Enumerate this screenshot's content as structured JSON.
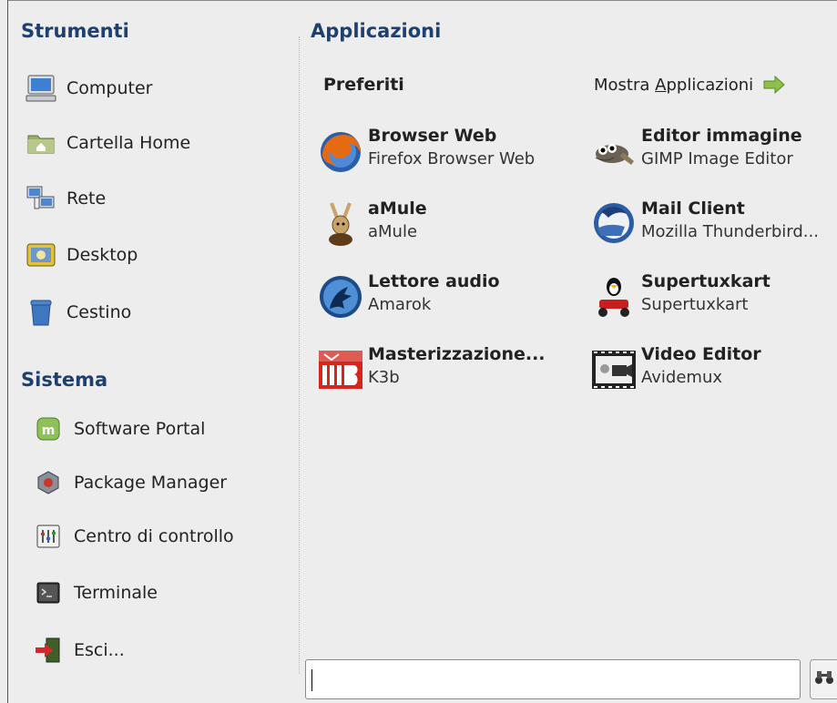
{
  "places": {
    "title": "Strumenti",
    "items": [
      {
        "label": "Computer",
        "icon": "computer-icon"
      },
      {
        "label": "Cartella Home",
        "icon": "home-folder-icon"
      },
      {
        "label": "Rete",
        "icon": "network-icon"
      },
      {
        "label": "Desktop",
        "icon": "desktop-icon"
      },
      {
        "label": "Cestino",
        "icon": "trash-icon"
      }
    ]
  },
  "system": {
    "title": "Sistema",
    "items": [
      {
        "label": "Software Portal",
        "icon": "software-portal-icon"
      },
      {
        "label": "Package Manager",
        "icon": "package-manager-icon"
      },
      {
        "label": "Centro di controllo",
        "icon": "control-center-icon"
      },
      {
        "label": "Terminale",
        "icon": "terminal-icon"
      },
      {
        "label": "Esci...",
        "icon": "logout-icon"
      }
    ]
  },
  "applications": {
    "title": "Applicazioni",
    "favorites_title": "Preferiti",
    "show_all_prefix": "Mostra ",
    "show_all_underlined": "A",
    "show_all_rest": "pplicazioni",
    "favorites": [
      {
        "name": "Browser Web",
        "desc": "Firefox Browser Web",
        "icon": "firefox-icon"
      },
      {
        "name": "Editor immagine",
        "desc": "GIMP Image Editor",
        "icon": "gimp-icon"
      },
      {
        "name": "aMule",
        "desc": "aMule",
        "icon": "amule-icon"
      },
      {
        "name": "Mail Client",
        "desc": "Mozilla Thunderbird...",
        "icon": "thunderbird-icon"
      },
      {
        "name": "Lettore audio",
        "desc": "Amarok",
        "icon": "amarok-icon"
      },
      {
        "name": "Supertuxkart",
        "desc": "Supertuxkart",
        "icon": "supertuxkart-icon"
      },
      {
        "name": "Masterizzazione...",
        "desc": "K3b",
        "icon": "k3b-icon"
      },
      {
        "name": "Video Editor",
        "desc": "Avidemux",
        "icon": "avidemux-icon"
      }
    ]
  },
  "search": {
    "value": "",
    "placeholder": ""
  },
  "colors": {
    "section_title": "#1f3f6e",
    "background": "#ededed"
  }
}
